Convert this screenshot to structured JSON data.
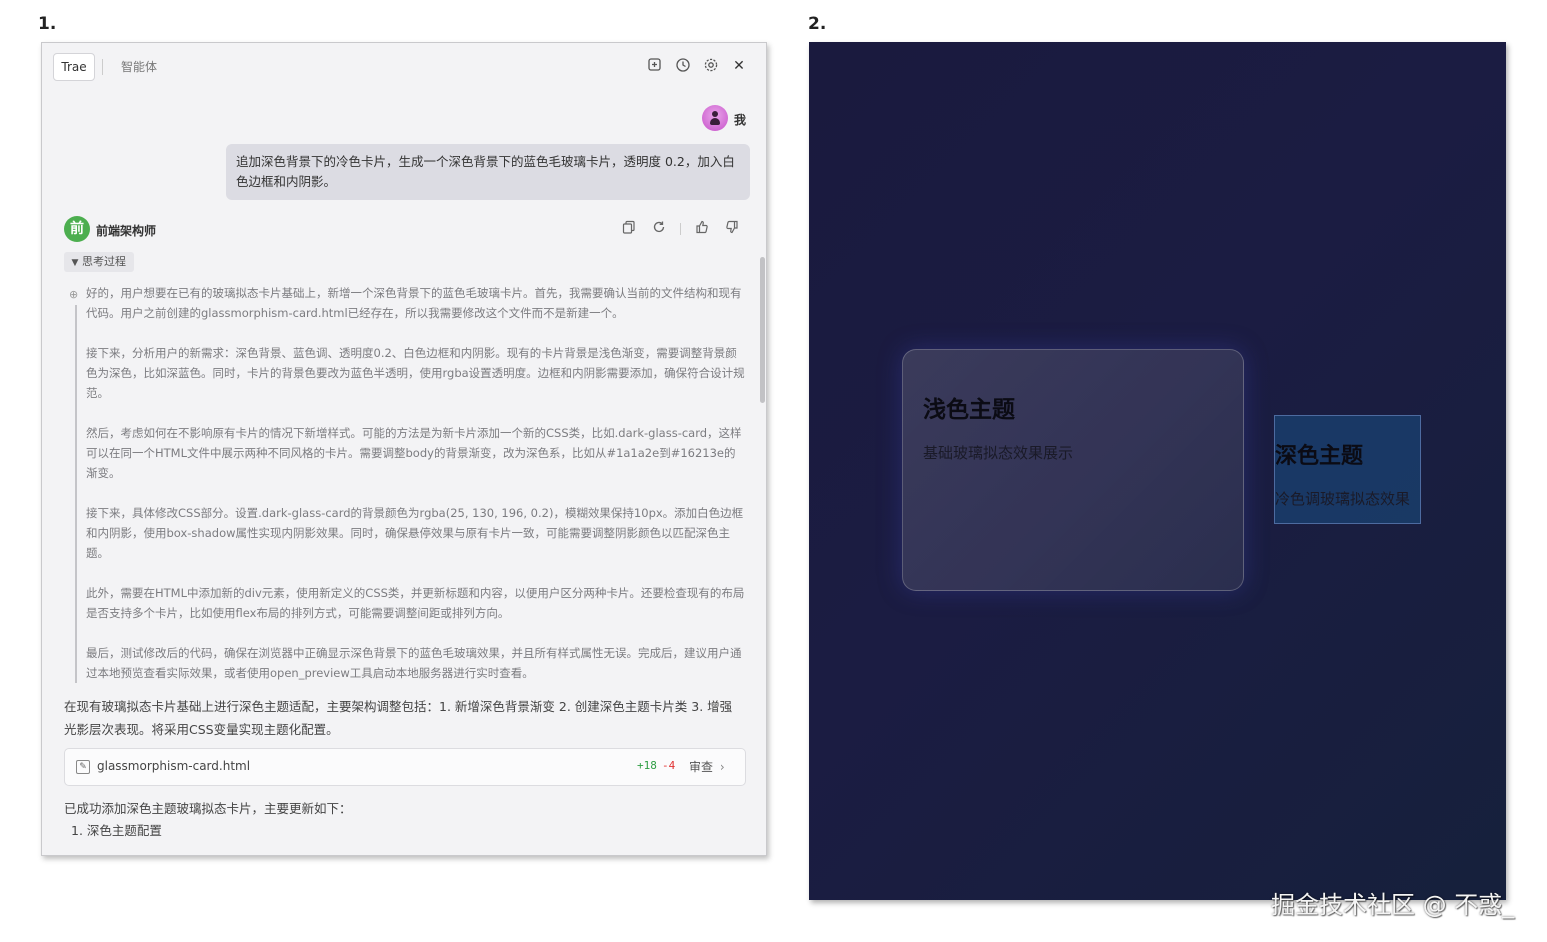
{
  "labels": {
    "step1": "1.",
    "step2": "2."
  },
  "chat": {
    "tabs": {
      "trae": "Trae",
      "agent": "智能体"
    },
    "header_icons": [
      "new-chat-icon",
      "history-icon",
      "settings-icon",
      "close-icon"
    ],
    "user": {
      "name": "我",
      "message": "追加深色背景下的冷色卡片，生成一个深色背景下的蓝色毛玻璃卡片，透明度 0.2，加入白色边框和内阴影。"
    },
    "bot": {
      "avatar_char": "前",
      "name": "前端架构师",
      "actions": [
        "copy-icon",
        "refresh-icon",
        "thumbs-up-icon",
        "thumbs-down-icon"
      ],
      "thinking_label": "思考过程",
      "thinking": [
        "好的，用户想要在已有的玻璃拟态卡片基础上，新增一个深色背景下的蓝色毛玻璃卡片。首先，我需要确认当前的文件结构和现有代码。用户之前创建的glassmorphism-card.html已经存在，所以我需要修改这个文件而不是新建一个。",
        "接下来，分析用户的新需求：深色背景、蓝色调、透明度0.2、白色边框和内阴影。现有的卡片背景是浅色渐变，需要调整背景颜色为深色，比如深蓝色。同时，卡片的背景色要改为蓝色半透明，使用rgba设置透明度。边框和内阴影需要添加，确保符合设计规范。",
        "然后，考虑如何在不影响原有卡片的情况下新增样式。可能的方法是为新卡片添加一个新的CSS类，比如.dark-glass-card，这样可以在同一个HTML文件中展示两种不同风格的卡片。需要调整body的背景渐变，改为深色系，比如从#1a1a2e到#16213e的渐变。",
        "接下来，具体修改CSS部分。设置.dark-glass-card的背景颜色为rgba(25, 130, 196, 0.2)，模糊效果保持10px。添加白色边框和内阴影，使用box-shadow属性实现内阴影效果。同时，确保悬停效果与原有卡片一致，可能需要调整阴影颜色以匹配深色主题。",
        "此外，需要在HTML中添加新的div元素，使用新定义的CSS类，并更新标题和内容，以便用户区分两种卡片。还要检查现有的布局是否支持多个卡片，比如使用flex布局的排列方式，可能需要调整间距或排列方向。",
        "最后，测试修改后的代码，确保在浏览器中正确显示深色背景下的蓝色毛玻璃效果，并且所有样式属性无误。完成后，建议用户通过本地预览查看实际效果，或者使用open_preview工具启动本地服务器进行实时查看。"
      ],
      "summary": "在现有玻璃拟态卡片基础上进行深色主题适配，主要架构调整包括：1. 新增深色背景渐变 2. 创建深色主题卡片类 3. 增强光影层次表现。将采用CSS变量实现主题化配置。",
      "file": {
        "name": "glassmorphism-card.html",
        "added": "+18",
        "removed": "-4",
        "review_label": "审查"
      },
      "result_text": "已成功添加深色主题玻璃拟态卡片，主要更新如下：",
      "result_items": [
        "1. 深色主题配置"
      ]
    }
  },
  "preview": {
    "light_card": {
      "title": "浅色主题",
      "subtitle": "基础玻璃拟态效果展示"
    },
    "dark_card": {
      "title": "深色主题",
      "subtitle": "冷色调玻璃拟态效果"
    },
    "colors": {
      "background_from": "#1a1a2e",
      "background_to": "#16213e",
      "card_blue": "rgba(25, 130, 196, 0.2)"
    }
  },
  "watermark": "掘金技术社区 @ 不惑_"
}
